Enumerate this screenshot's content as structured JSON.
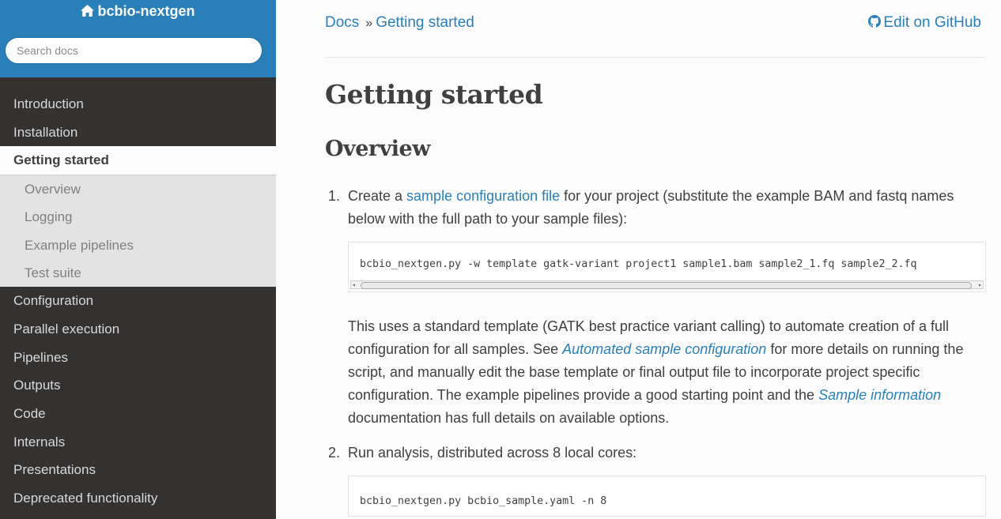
{
  "sidebar": {
    "project_name": "bcbio-nextgen",
    "search_placeholder": "Search docs",
    "items": [
      {
        "label": "Introduction"
      },
      {
        "label": "Installation"
      },
      {
        "label": "Getting started",
        "current": true
      },
      {
        "label": "Configuration"
      },
      {
        "label": "Parallel execution"
      },
      {
        "label": "Pipelines"
      },
      {
        "label": "Outputs"
      },
      {
        "label": "Code"
      },
      {
        "label": "Internals"
      },
      {
        "label": "Presentations"
      },
      {
        "label": "Deprecated functionality"
      }
    ],
    "subitems": [
      {
        "label": "Overview"
      },
      {
        "label": "Logging"
      },
      {
        "label": "Example pipelines"
      },
      {
        "label": "Test suite"
      }
    ]
  },
  "breadcrumbs": {
    "docs": "Docs",
    "separator": "»",
    "current": "Getting started",
    "edit": "Edit on GitHub"
  },
  "page": {
    "title": "Getting started",
    "section": "Overview",
    "steps": {
      "one": {
        "number": "1.",
        "pre": "Create a ",
        "link": "sample configuration file",
        "post": " for your project (substitute the example BAM and fastq names below with the full path to your sample files):",
        "code": "bcbio_nextgen.py -w template gatk-variant project1 sample1.bam sample2_1.fq sample2_2.fq",
        "para_a": "This uses a standard template (GATK best practice variant calling) to automate creation of a full configuration for all samples. See ",
        "link_a": "Automated sample configuration",
        "para_b": " for more details on running the script, and manually edit the base template or final output file to incorporate project specific configuration. The example pipelines provide a good starting point and the ",
        "link_b": "Sample information",
        "para_c": " documentation has full details on available options."
      },
      "two": {
        "number": "2.",
        "text": "Run analysis, distributed across 8 local cores:",
        "code": "bcbio_nextgen.py bcbio_sample.yaml -n 8"
      }
    }
  },
  "colors": {
    "sidebar_bg": "#343131",
    "brand": "#2980b9",
    "link": "#2980b9",
    "text": "#404040"
  },
  "icons": {
    "home": "home-icon",
    "github": "github-icon"
  }
}
